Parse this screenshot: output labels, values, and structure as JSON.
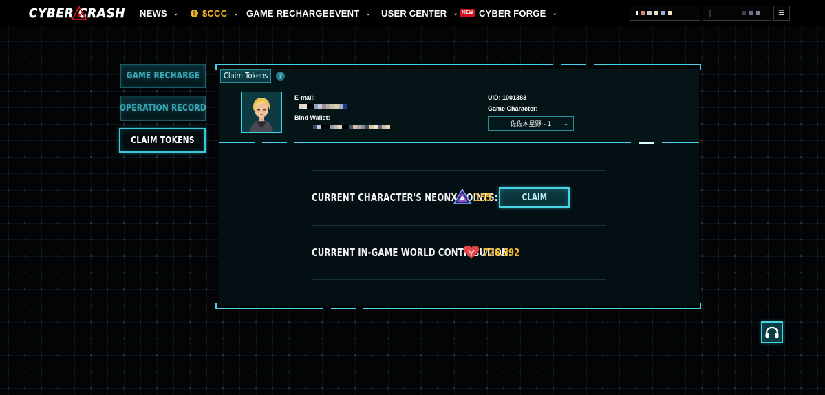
{
  "header": {
    "logo_text": "CYBER  CRASH",
    "nav": [
      {
        "label": "NEWS",
        "has_dropdown": true
      },
      {
        "label": "$CCC",
        "has_dropdown": true,
        "icon": "coin-icon",
        "color": "#f5b523"
      },
      {
        "label": "GAME RECHARGE",
        "has_dropdown": false
      },
      {
        "label": "EVENT",
        "has_dropdown": true
      },
      {
        "label": "USER CENTER",
        "has_dropdown": true
      },
      {
        "label": "CYBER FORGE",
        "has_dropdown": true,
        "badge": "NEW"
      }
    ],
    "menu_icon": "menu-icon"
  },
  "sidebar": {
    "items": [
      {
        "label": "GAME RECHARGE",
        "active": false
      },
      {
        "label": "OPERATION RECORD",
        "active": false
      },
      {
        "label": "CLAIM TOKENS",
        "active": true
      }
    ]
  },
  "panel": {
    "tab_label": "Claim Tokens",
    "help_label": "?",
    "email_label": "E-mail:",
    "wallet_label": "Bind Wallet:",
    "uid_label": "UID: 1001383",
    "character_label": "Game Character:",
    "character_selected": "佐佐木星野 - 1"
  },
  "points": {
    "label": "CURRENT CHARACTER'S NEONX POINTS:",
    "value": "155",
    "button_label": "CLAIM"
  },
  "contribution": {
    "label": "CURRENT IN-GAME WORLD CONTRIBUTION:",
    "value": "726.392"
  },
  "colors": {
    "accent": "#47d3e6",
    "value": "#f5b523",
    "badge": "#d2121c"
  }
}
